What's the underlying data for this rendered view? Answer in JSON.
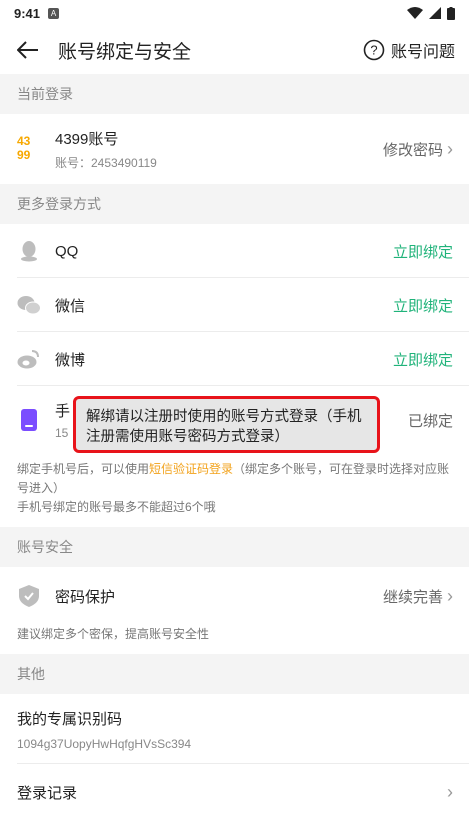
{
  "status_bar": {
    "time": "9:41",
    "badge": "A"
  },
  "header": {
    "title": "账号绑定与安全",
    "help_label": "账号问题"
  },
  "current_login": {
    "section_label": "当前登录",
    "account_name": "4399账号",
    "account_sub": "账号：2453490119",
    "action": "修改密码",
    "logo_line1": "43",
    "logo_line2": "99"
  },
  "more_login": {
    "section_label": "更多登录方式",
    "items": [
      {
        "label": "QQ",
        "action": "立即绑定",
        "icon": "qq-icon"
      },
      {
        "label": "微信",
        "action": "立即绑定",
        "icon": "wechat-icon"
      },
      {
        "label": "微博",
        "action": "立即绑定",
        "icon": "weibo-icon"
      }
    ],
    "phone": {
      "label_visible": "手",
      "sub_visible": "15",
      "action": "已绑定"
    },
    "note_part1": "绑定手机号后，可以使用",
    "note_link": "短信验证码登录",
    "note_part2": "（绑定多个账号，可在登录时选择对应账号进入）",
    "note_line2": "手机号绑定的账号最多不能超过6个哦"
  },
  "account_security": {
    "section_label": "账号安全",
    "item_label": "密码保护",
    "item_action": "继续完善",
    "note": "建议绑定多个密保，提高账号安全性"
  },
  "other": {
    "section_label": "其他",
    "id_label": "我的专属识别码",
    "id_code": "1094g37UopyHwHqfgHVsSc394",
    "login_log_label": "登录记录"
  },
  "toast": {
    "text": "解绑请以注册时使用的账号方式登录（手机注册需使用账号密码方式登录）"
  },
  "colors": {
    "accent_green": "#20b37a",
    "link_orange": "#f2a21b",
    "toast_border": "#e8131a",
    "brand_yellow": "#f7a800"
  }
}
